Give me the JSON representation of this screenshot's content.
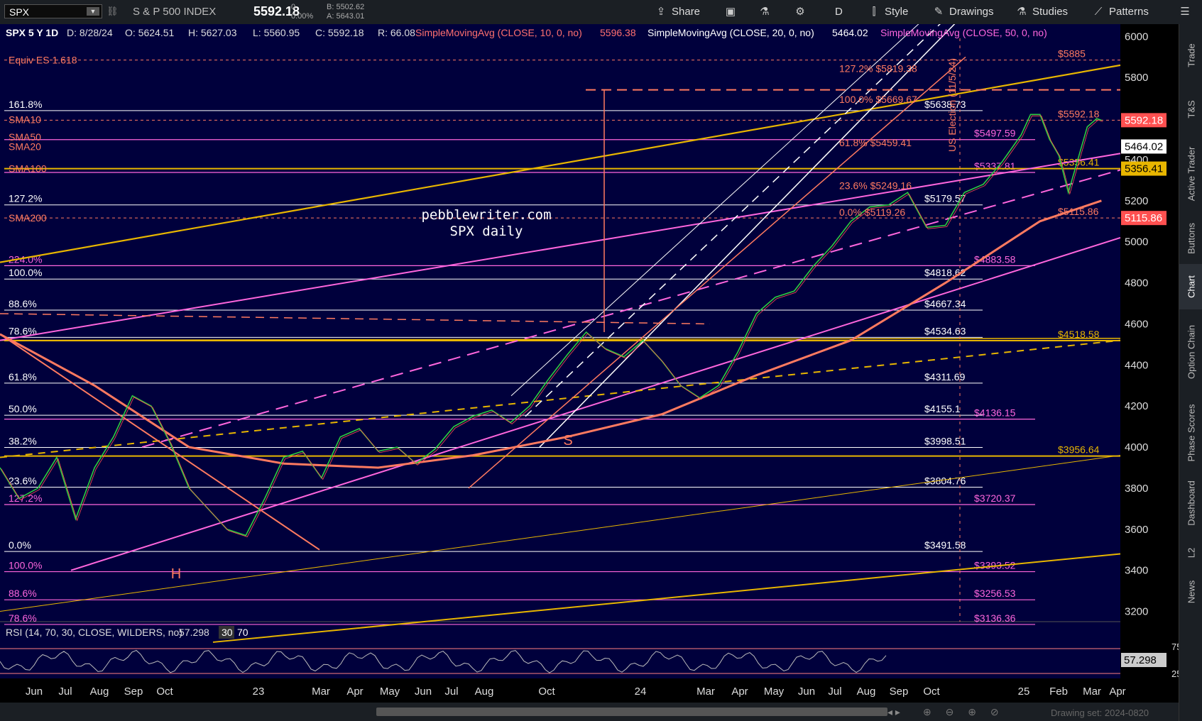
{
  "toolbar": {
    "symbol": "SPX",
    "description": "S & P 500 INDEX",
    "price": "5592.18",
    "change": "0",
    "change_pct": "0.00%",
    "bid": "B: 5502.62",
    "ask": "A: 5643.01",
    "share": "Share",
    "period": "D",
    "style": "Style",
    "drawings": "Drawings",
    "studies": "Studies",
    "patterns": "Patterns"
  },
  "header": {
    "title": "SPX 5 Y 1D",
    "date": "D: 8/28/24",
    "open": "O: 5624.51",
    "high": "H: 5627.03",
    "low": "L: 5560.95",
    "close": "C: 5592.18",
    "range": "R: 66.08",
    "sma10": "SimpleMovingAvg (CLOSE, 10, 0, no)",
    "sma10_val": "5596.38",
    "sma20": "SimpleMovingAvg (CLOSE, 20, 0, no)",
    "sma20_val": "5464.02",
    "sma50": "SimpleMovingAvg (CLOSE, 50, 0, no)"
  },
  "sidebar": [
    "Trade",
    "T&S",
    "Active Trader",
    "Buttons",
    "Chart",
    "Option Chain",
    "Phase Scores",
    "Dashboard",
    "L2",
    "News"
  ],
  "sidebar_active": "Chart",
  "rsi_label": "RSI (14, 70, 30, CLOSE, WILDERS, no)",
  "rsi_value": "57.298",
  "rsi_ob": "30",
  "rsi_os": "70",
  "rsi_ticks": [
    "75",
    "25"
  ],
  "drawing_set": "Drawing set: 2024-0820",
  "watermark": {
    "line1": "pebblewriter.com",
    "line2": "SPX daily"
  },
  "equiv_label": "Equiv ES 1.618",
  "us_election": "US Election (11/5/24)",
  "colors": {
    "bg": "#00003c",
    "pink": "#ff66dd",
    "salmon": "#ff7a60",
    "gold": "#e8b600",
    "white": "#ffffff",
    "red_line": "#ff4444"
  },
  "chart_data": {
    "type": "line",
    "ylim": [
      3150,
      6060
    ],
    "y_ticks": [
      6000,
      5800,
      5600,
      5400,
      5200,
      5000,
      4800,
      4600,
      4400,
      4200,
      4000,
      3800,
      3600,
      3400,
      3200
    ],
    "x_ticks": [
      "Jun",
      "Jul",
      "Aug",
      "Sep",
      "Oct",
      "23",
      "Mar",
      "Apr",
      "May",
      "Jun",
      "Jul",
      "Aug",
      "Oct",
      "24",
      "Mar",
      "Apr",
      "May",
      "Jun",
      "Jul",
      "Aug",
      "Sep",
      "Oct",
      "25",
      "Feb",
      "Mar",
      "Apr"
    ],
    "price_path": [
      [
        0,
        3900
      ],
      [
        20,
        3750
      ],
      [
        40,
        3800
      ],
      [
        60,
        3950
      ],
      [
        80,
        3650
      ],
      [
        100,
        3900
      ],
      [
        120,
        4050
      ],
      [
        140,
        4250
      ],
      [
        160,
        4200
      ],
      [
        180,
        4020
      ],
      [
        200,
        3800
      ],
      [
        220,
        3700
      ],
      [
        240,
        3600
      ],
      [
        260,
        3570
      ],
      [
        280,
        3750
      ],
      [
        300,
        3950
      ],
      [
        320,
        3980
      ],
      [
        340,
        3850
      ],
      [
        360,
        4050
      ],
      [
        380,
        4090
      ],
      [
        400,
        3980
      ],
      [
        420,
        4000
      ],
      [
        440,
        3920
      ],
      [
        460,
        3990
      ],
      [
        480,
        4100
      ],
      [
        500,
        4150
      ],
      [
        520,
        4180
      ],
      [
        540,
        4120
      ],
      [
        560,
        4200
      ],
      [
        580,
        4330
      ],
      [
        600,
        4450
      ],
      [
        620,
        4560
      ],
      [
        640,
        4480
      ],
      [
        660,
        4440
      ],
      [
        680,
        4520
      ],
      [
        700,
        4420
      ],
      [
        720,
        4300
      ],
      [
        740,
        4240
      ],
      [
        760,
        4300
      ],
      [
        780,
        4460
      ],
      [
        800,
        4650
      ],
      [
        820,
        4730
      ],
      [
        840,
        4760
      ],
      [
        860,
        4880
      ],
      [
        880,
        4980
      ],
      [
        900,
        5100
      ],
      [
        920,
        5170
      ],
      [
        940,
        5180
      ],
      [
        960,
        5240
      ],
      [
        980,
        5070
      ],
      [
        1000,
        5080
      ],
      [
        1020,
        5240
      ],
      [
        1040,
        5280
      ],
      [
        1060,
        5390
      ],
      [
        1080,
        5520
      ],
      [
        1090,
        5620
      ],
      [
        1100,
        5620
      ],
      [
        1110,
        5500
      ],
      [
        1120,
        5420
      ],
      [
        1130,
        5240
      ],
      [
        1140,
        5400
      ],
      [
        1150,
        5560
      ],
      [
        1160,
        5600
      ],
      [
        1165,
        5592
      ]
    ],
    "sma200_path": [
      [
        0,
        4550
      ],
      [
        100,
        4300
      ],
      [
        200,
        4000
      ],
      [
        300,
        3920
      ],
      [
        400,
        3900
      ],
      [
        500,
        3960
      ],
      [
        600,
        4050
      ],
      [
        700,
        4160
      ],
      [
        800,
        4350
      ],
      [
        900,
        4520
      ],
      [
        1000,
        4800
      ],
      [
        1100,
        5100
      ],
      [
        1165,
        5200
      ]
    ],
    "fib_levels": [
      {
        "label": "161.8%",
        "price": "$5638.73",
        "y": 5638.73
      },
      {
        "label": "127.2%",
        "price": "$5179.57",
        "y": 5179.57
      },
      {
        "label": "100.0%",
        "price": "$4818.62",
        "y": 4818.62
      },
      {
        "label": "88.6%",
        "price": "$4667.34",
        "y": 4667.34
      },
      {
        "label": "78.6%",
        "price": "$4534.63",
        "y": 4534.63
      },
      {
        "label": "61.8%",
        "price": "$4311.69",
        "y": 4311.69
      },
      {
        "label": "50.0%",
        "price": "$4155.1",
        "y": 4155.1
      },
      {
        "label": "38.2%",
        "price": "$3998.51",
        "y": 3998.51
      },
      {
        "label": "23.6%",
        "price": "$3804.76",
        "y": 3804.76
      },
      {
        "label": "0.0%",
        "price": "$3491.58",
        "y": 3491.58
      }
    ],
    "pink_levels": [
      {
        "label": "224.0%",
        "price": "$4883.58",
        "y": 4883.58
      },
      {
        "label": "127.2%",
        "price": "$3720.37",
        "y": 3720.37
      },
      {
        "label": "100.0%",
        "price": "$3393.52",
        "y": 3393.52
      },
      {
        "label": "88.6%",
        "price": "$3256.53",
        "y": 3256.53
      },
      {
        "label": "78.6%",
        "price": "$3136.36",
        "y": 3136.36
      },
      {
        "label": "",
        "price": "$5337.81",
        "y": 5337.81
      },
      {
        "label": "",
        "price": "$4136.15",
        "y": 4136.15
      },
      {
        "label": "",
        "price": "$5497.59",
        "y": 5497.59
      }
    ],
    "gold_levels": [
      {
        "price": "$5356.41",
        "y": 5356.41
      },
      {
        "price": "$4518.58",
        "y": 4518.58
      },
      {
        "price": "$3956.64",
        "y": 3956.64
      }
    ],
    "salmon_levels": [
      {
        "price": "$5885",
        "y": 5885
      },
      {
        "price": "$5592.18",
        "y": 5592.18
      },
      {
        "price": "$5115.86",
        "y": 5115.86
      }
    ],
    "ma_labels": [
      {
        "text": "SMA10",
        "y": 5596
      },
      {
        "text": "SMA50",
        "y": 5510
      },
      {
        "text": "SMA20",
        "y": 5464
      },
      {
        "text": "SMA100",
        "y": 5356
      },
      {
        "text": "SMA200",
        "y": 5116
      }
    ],
    "inner_fibs": [
      {
        "text": "127.2%  $5819.38",
        "y": 5819.38
      },
      {
        "text": "100.0%  $5669.67",
        "y": 5669.67
      },
      {
        "text": "61.8%  $5459.41",
        "y": 5459.41
      },
      {
        "text": "23.6%  $5249.16",
        "y": 5249.16
      },
      {
        "text": "0.0%  $5119.26",
        "y": 5119.26
      }
    ],
    "price_tags": [
      {
        "text": "5592.18",
        "y": 5592.18,
        "color": "#ff5050",
        "fg": "#fff"
      },
      {
        "text": "5464.02",
        "y": 5464.02,
        "color": "#ffffff",
        "fg": "#000"
      },
      {
        "text": "5356.41",
        "y": 5356.41,
        "color": "#e8b600",
        "fg": "#000"
      },
      {
        "text": "5115.86",
        "y": 5115.86,
        "color": "#ff5050",
        "fg": "#fff"
      }
    ],
    "markers": [
      {
        "text": "H"
      },
      {
        "text": "S"
      }
    ]
  }
}
